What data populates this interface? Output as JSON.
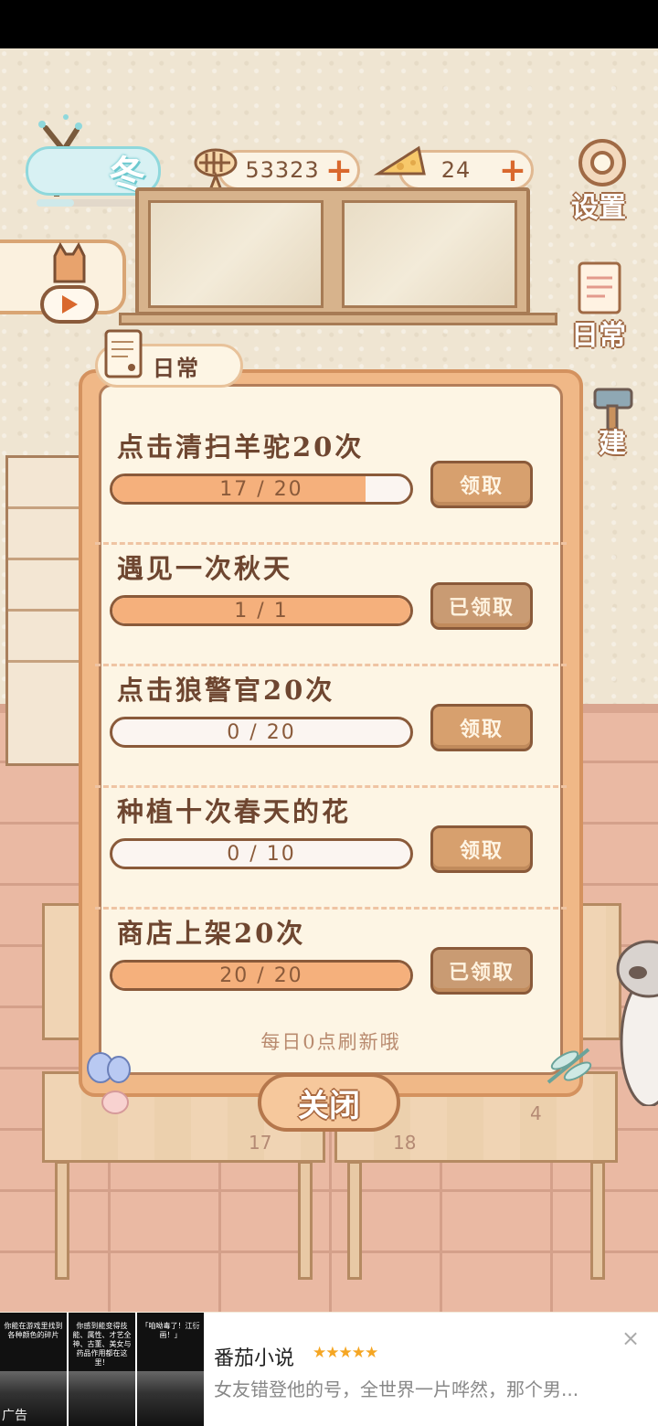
{
  "season": {
    "label": "冬",
    "progress": 0.3
  },
  "currency": {
    "fish": {
      "amount": "53323",
      "plus": "+"
    },
    "cheese": {
      "amount": "24",
      "plus": "+"
    }
  },
  "side_menu": {
    "settings": "设置",
    "daily": "日常",
    "build_partial": "建"
  },
  "dialog": {
    "tab_title": "日常",
    "tasks": [
      {
        "title": "点击清扫羊驼20次",
        "progress_text": "17 / 20",
        "current": 17,
        "target": 20,
        "button": "领取",
        "claimed": false
      },
      {
        "title": "遇见一次秋天",
        "progress_text": "1 / 1",
        "current": 1,
        "target": 1,
        "button": "已领取",
        "claimed": true
      },
      {
        "title": "点击狼警官20次",
        "progress_text": "0 / 20",
        "current": 0,
        "target": 20,
        "button": "领取",
        "claimed": false
      },
      {
        "title": "种植十次春天的花",
        "progress_text": "0 / 10",
        "current": 0,
        "target": 10,
        "button": "领取",
        "claimed": false
      },
      {
        "title": "商店上架20次",
        "progress_text": "20 / 20",
        "current": 20,
        "target": 20,
        "button": "已领取",
        "claimed": true
      }
    ],
    "refresh_note": "每日0点刷新哦",
    "close_label": "关闭"
  },
  "table_numbers": [
    "17",
    "18",
    "4"
  ],
  "ad": {
    "thumbs": [
      {
        "caption": "你能在游戏里找到各种颜色的碎片",
        "tag": "广告"
      },
      {
        "caption": "你感到能变得技能、属性、才艺全神、古董、美女与药品作用都在这里！",
        "tag": ""
      },
      {
        "caption": "「咱呦毒了！江衍画！」",
        "tag": ""
      }
    ],
    "title": "番茄小说",
    "stars": "★★★★★",
    "description": "女友错登他的号，全世界一片哗然，那个男...",
    "close": "×"
  }
}
